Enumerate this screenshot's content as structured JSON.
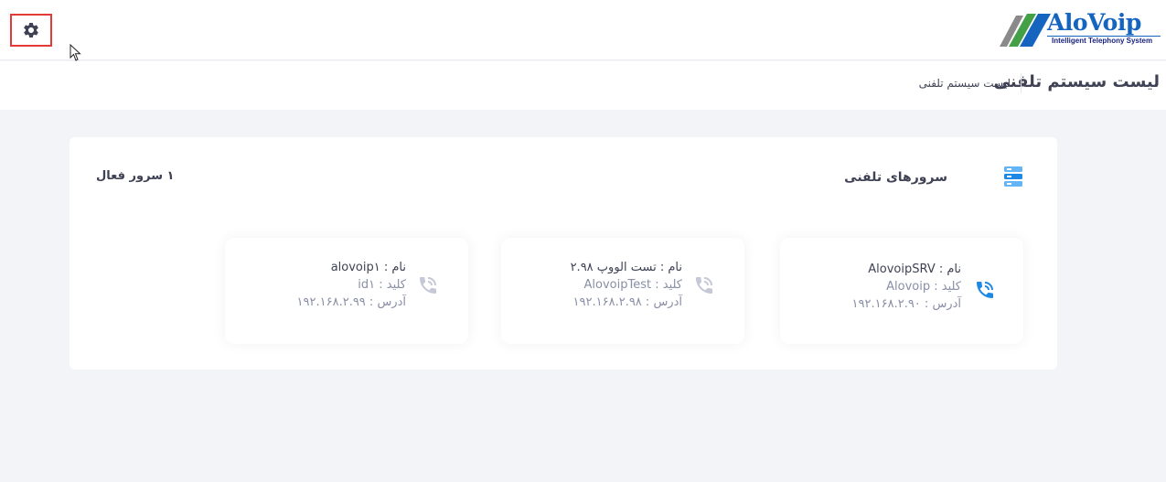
{
  "header": {
    "logo_text": "AloVoip",
    "logo_tagline": "Intelligent Telephony System"
  },
  "subheader": {
    "title": "لیست سیستم تلفنی",
    "breadcrumb": "لیست سیستم تلفنی"
  },
  "servers_panel": {
    "title": "سرورهای تلفنی",
    "active_count": "۱ سرور فعال",
    "servers": [
      {
        "name": "نام : AlovoipSRV",
        "key": "کلید : Alovoip",
        "address": "آدرس : ۱۹۲.۱۶۸.۲.۹۰",
        "status": "active",
        "phone_color": "#1e88e5"
      },
      {
        "name": "نام : تست الووپ ۲.۹۸",
        "key": "کلید : AlovoipTest",
        "address": "آدرس : ۱۹۲.۱۶۸.۲.۹۸",
        "status": "inactive",
        "phone_color": "#c5c8d6"
      },
      {
        "name": "نام : alovoip۱",
        "key": "کلید : id۱",
        "address": "آدرس : ۱۹۲.۱۶۸.۲.۹۹",
        "status": "inactive",
        "phone_color": "#c5c8d6"
      }
    ]
  },
  "colors": {
    "accent": "#1e88e5",
    "highlight_border": "#e53935",
    "background": "#f2f4f7"
  },
  "icons": {
    "settings": "gear-icon",
    "servers": "server-stack-icon",
    "server_phone": "phone-ringing-icon"
  }
}
